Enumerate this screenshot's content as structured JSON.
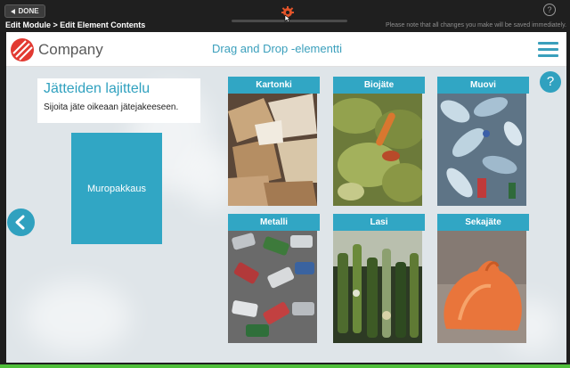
{
  "editor": {
    "done_label": "DONE",
    "breadcrumb": "Edit Module > Edit Element Contents",
    "save_note": "Please note that all changes you make will be saved immediately.",
    "help_label": "?"
  },
  "page": {
    "company": "Company",
    "header_title": "Drag and Drop -elementti",
    "help_label": "?"
  },
  "task": {
    "title": "Jätteiden lajittelu",
    "instruction": "Sijoita jäte oikeaan jätejakeeseen.",
    "item": "Muropakkaus"
  },
  "bins": [
    {
      "label": "Kartonki",
      "photo": "cardboard-pile"
    },
    {
      "label": "Biojäte",
      "photo": "food-waste"
    },
    {
      "label": "Muovi",
      "photo": "plastic-bottles"
    },
    {
      "label": "Metalli",
      "photo": "metal-cans"
    },
    {
      "label": "Lasi",
      "photo": "glass-bottles"
    },
    {
      "label": "Sekajäte",
      "photo": "orange-trash-bag"
    }
  ],
  "colors": {
    "accent": "#30a1bf",
    "tile": "#31a6c4",
    "logo": "#e23a32",
    "gear": "#e2542a"
  }
}
